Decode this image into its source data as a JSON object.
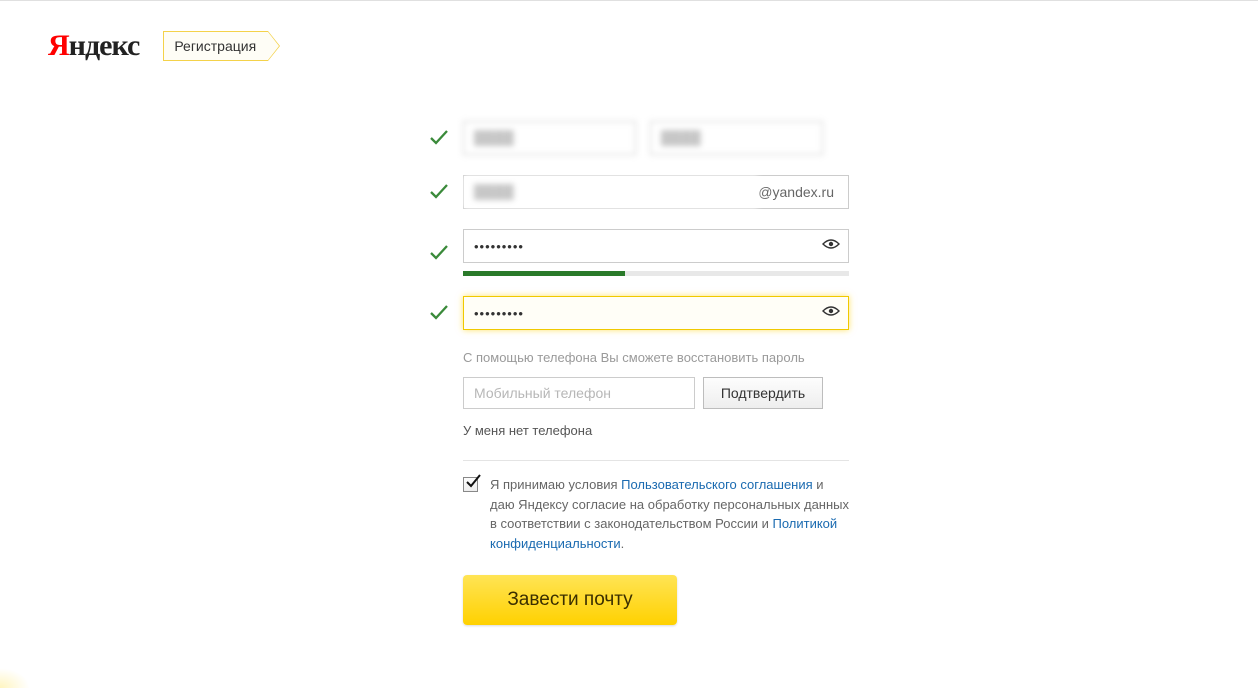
{
  "header": {
    "logo_ya": "Я",
    "logo_rest": "ндекс",
    "registration_label": "Регистрация"
  },
  "form": {
    "first_name": "████",
    "last_name": "████",
    "login_value": "████",
    "login_suffix": "@yandex.ru",
    "password_value": "•••••••••",
    "password_confirm_value": "•••••••••",
    "password_strength_percent": 42,
    "phone": {
      "help_text": "С помощью телефона Вы сможете восстановить пароль",
      "placeholder": "Мобильный телефон",
      "confirm_label": "Подтвердить",
      "no_phone_label": "У меня нет телефона"
    },
    "terms": {
      "checked": true,
      "prefix": "Я принимаю условия ",
      "link1": "Пользовательского соглашения",
      "mid1": " и даю Яндексу согласие на обработку персональных данных в соответствии с законодательством России и ",
      "link2": "Политикой конфиденциальности",
      "suffix": "."
    },
    "submit_label": "Завести почту"
  },
  "icons": {
    "check": "check-icon",
    "eye": "eye-icon"
  }
}
